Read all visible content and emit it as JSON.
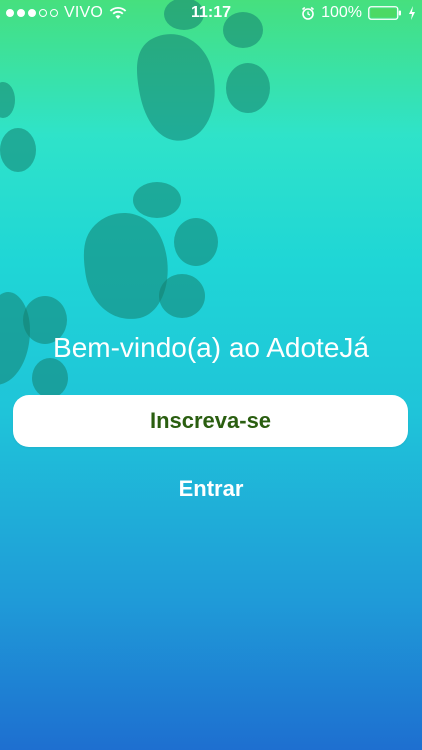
{
  "status_bar": {
    "carrier": "VIVO",
    "time": "11:17",
    "battery": "100%",
    "signal_strength": 3,
    "icons": [
      "wifi-icon",
      "alarm-icon",
      "battery-icon",
      "charging-icon"
    ]
  },
  "welcome": {
    "title": "Bem-vindo(a) ao AdoteJá"
  },
  "actions": {
    "signup_label": "Inscreva-se",
    "login_label": "Entrar"
  },
  "colors": {
    "signup_text": "#2a5e10",
    "background_top": "#46e07e",
    "background_bottom": "#1e6fd0",
    "paw_color": "#1a8f7f"
  }
}
